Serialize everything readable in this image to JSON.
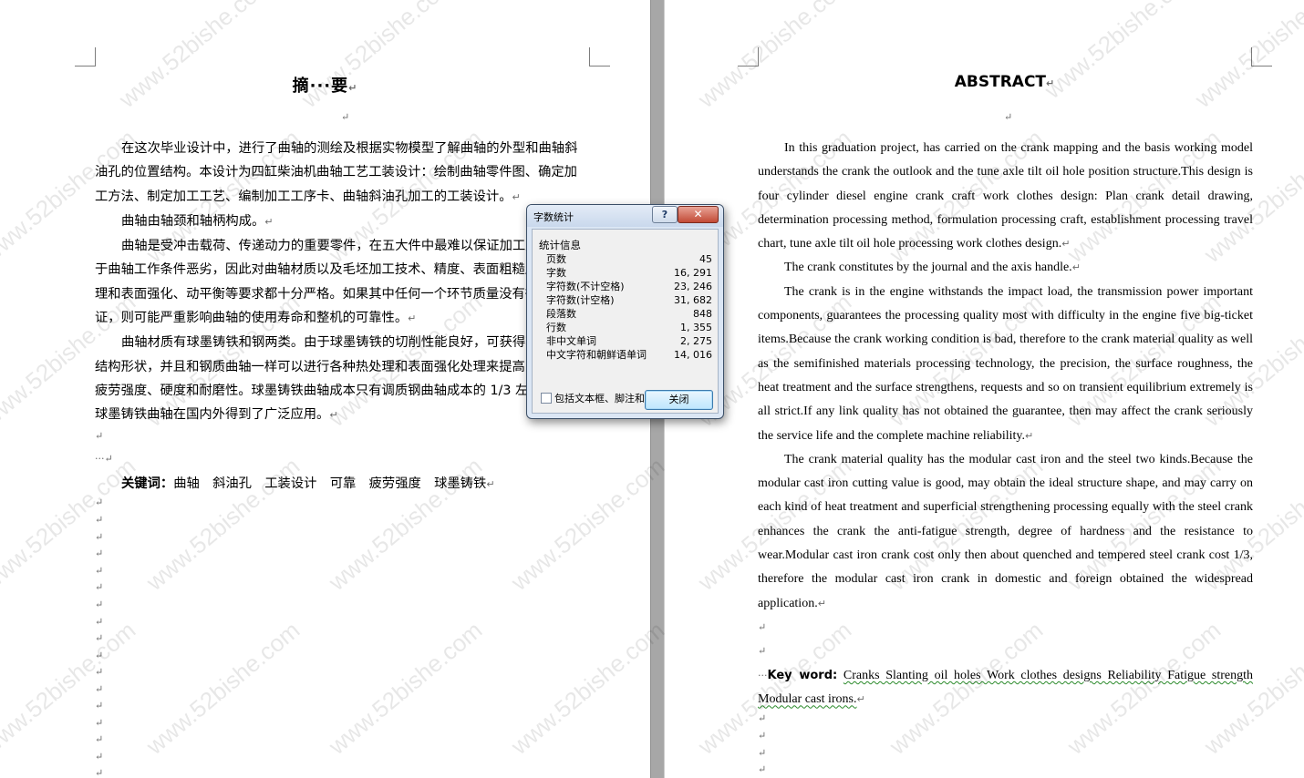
{
  "left_page": {
    "title": "摘···要",
    "paragraphs": [
      "在这次毕业设计中，进行了曲轴的测绘及根据实物模型了解曲轴的外型和曲轴斜油孔的位置结构。本设计为四缸柴油机曲轴工艺工装设计：绘制曲轴零件图、确定加工方法、制定加工工艺、编制加工工序卡、曲轴斜油孔加工的工装设计。",
      "曲轴由轴颈和轴柄构成。",
      "曲轴是受冲击载荷、传递动力的重要零件，在五大件中最难以保证加工质量，由于曲轴工作条件恶劣，因此对曲轴材质以及毛坯加工技术、精度、表面粗糙度、热处理和表面强化、动平衡等要求都十分严格。如果其中任何一个环节质量没有得到保证，则可能严重影响曲轴的使用寿命和整机的可靠性。",
      "曲轴材质有球墨铸铁和钢两类。由于球墨铸铁的切削性能良好，可获得较理想的结构形状，并且和钢质曲轴一样可以进行各种热处理和表面强化处理来提高曲轴的抗疲劳强度、硬度和耐磨性。球墨铸铁曲轴成本只有调质钢曲轴成本的 1/3 左右，所以球墨铸铁曲轴在国内外得到了广泛应用。"
    ],
    "keywords_label": "关键词：",
    "keywords": "曲轴　斜油孔　工装设计　可靠　疲劳强度　球墨铸铁"
  },
  "right_page": {
    "title": "ABSTRACT",
    "p1": "In this graduation project, has carried on the crank mapping and the basis working model understands the crank the outlook and the tune axle tilt oil hole position structure.This design is four cylinder diesel engine crank craft work clothes design: Plan crank detail drawing, determination processing method, formulation processing craft, establishment processing travel chart, tune axle tilt oil hole processing work clothes design.",
    "p2": "The crank constitutes by the journal and the axis handle.",
    "p3": "The crank is in the engine withstands the impact load, the transmission power important components, guarantees the processing quality most with difficulty in the engine five big-ticket items.Because the crank working condition is bad, therefore to the crank material quality as well as the semifinished materials processing technology, the precision, the surface roughness, the heat treatment and the surface strengthens, requests and so on transient equilibrium extremely is all strict.If any link quality has not obtained the guarantee, then may affect the crank seriously the service life and the complete machine reliability.",
    "p4": "The crank material quality has the modular cast iron and the steel two kinds.Because the modular cast iron cutting value is good, may obtain the ideal structure shape, and may carry on each kind of heat treatment and superficial strengthening processing equally with the steel crank enhances the crank the anti-fatigue strength, degree of hardness and the resistance to wear.Modular cast iron crank cost only then about quenched and tempered steel crank cost 1/3, therefore the modular cast iron crank in domestic and foreign obtained the widespread application.",
    "keywords_label": "Key word:",
    "keywords": "Cranks  Slanting oil holes  Work clothes designs  Reliability  Fatigue strength  Modular cast irons."
  },
  "watermark": "www.52bishe.com",
  "dialog": {
    "title": "字数统计",
    "help": "?",
    "close_x": "✕",
    "group_label": "统计信息",
    "stats": [
      {
        "label": "页数",
        "value": "45"
      },
      {
        "label": "字数",
        "value": "16, 291"
      },
      {
        "label": "字符数(不计空格)",
        "value": "23, 246"
      },
      {
        "label": "字符数(计空格)",
        "value": "31, 682"
      },
      {
        "label": "段落数",
        "value": "848"
      },
      {
        "label": "行数",
        "value": "1, 355"
      },
      {
        "label": "非中文单词",
        "value": "2, 275"
      },
      {
        "label": "中文字符和朝鲜语单词",
        "value": "14, 016"
      }
    ],
    "checkbox_label": "包括文本框、脚注和尾注(F)",
    "close_button": "关闭"
  },
  "colors": {
    "gutter": "#a7a7a7",
    "spell_error": "#c00000",
    "grammar": "#2a8a2a",
    "dialog_frame": "#dbe6f4"
  }
}
